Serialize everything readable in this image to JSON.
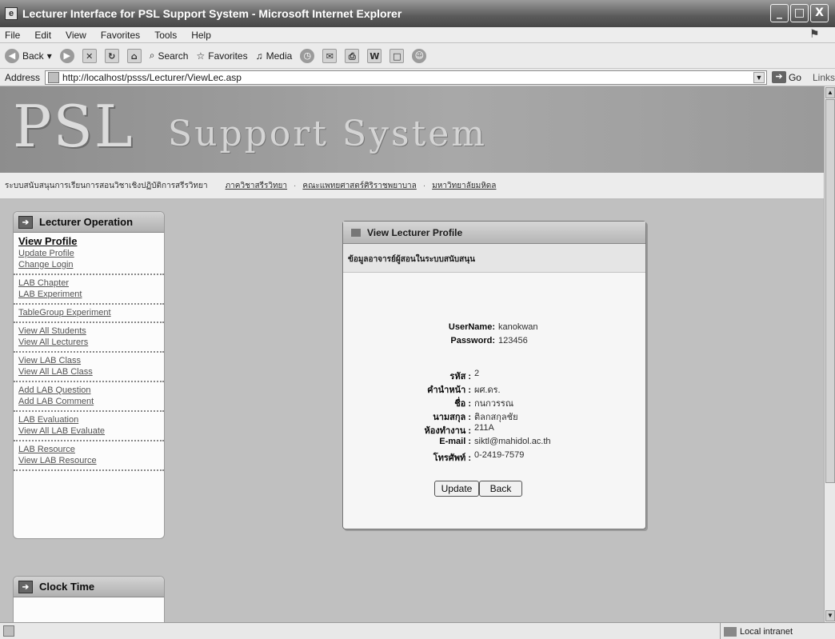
{
  "window": {
    "title": "Lecturer Interface for PSL Support System - Microsoft Internet Explorer",
    "controls": [
      "_",
      "□",
      "X"
    ]
  },
  "menu": [
    "File",
    "Edit",
    "View",
    "Favorites",
    "Tools",
    "Help"
  ],
  "toolbar": {
    "back": "Back",
    "search": "Search",
    "favorites": "Favorites",
    "media": "Media"
  },
  "address": {
    "label": "Address",
    "url": "http://localhost/psss/Lecturer/ViewLec.asp",
    "go": "Go",
    "links": "Links"
  },
  "banner": {
    "logo": "PSL",
    "logo_sub": "Support System"
  },
  "navstrip": {
    "system_name": "ระบบสนับสนุนการเรียนการสอนวิชาเชิงปฏิบัติการสรีรวิทยา",
    "links": [
      "ภาควิชาสรีรวิทยา",
      "คณะแพทยศาสตร์ศิริราชพยาบาล",
      "มหาวิทยาลัยมหิดล"
    ]
  },
  "left_panel": {
    "title": "Lecturer Operation",
    "groups": [
      [
        "View Profile",
        "Update Profile",
        "Change Login"
      ],
      [
        "LAB Chapter",
        "LAB Experiment"
      ],
      [
        "TableGroup Experiment"
      ],
      [
        "View All Students",
        "View All Lecturers"
      ],
      [
        "View LAB Class",
        "View All LAB Class"
      ],
      [
        "Add LAB Question",
        "Add LAB Comment"
      ],
      [
        "LAB Evaluation",
        "View All LAB Evaluate"
      ],
      [
        "LAB Resource",
        "View LAB Resource"
      ]
    ]
  },
  "clock_panel": {
    "title": "Clock Time"
  },
  "dialog": {
    "title": "View Lecturer Profile",
    "subtitle": "ข้อมูลอาจารย์ผู้สอนในระบบสนับสนุน",
    "login": [
      {
        "label": "UserName:",
        "value": "kanokwan"
      },
      {
        "label": "Password:",
        "value": "123456"
      }
    ],
    "fields": [
      {
        "label": "รหัส :",
        "value": "2"
      },
      {
        "label": "คำนำหน้า :",
        "value": "ผศ.ดร."
      },
      {
        "label": "ชื่อ :",
        "value": "กนกวรรณ"
      },
      {
        "label": "นามสกุล :",
        "value": "ติลกสกุลชัย"
      },
      {
        "label": "ห้องทำงาน :",
        "value": "211A"
      },
      {
        "label": "E-mail :",
        "value": "siktl@mahidol.ac.th"
      },
      {
        "label": "โทรศัพท์ :",
        "value": "0-2419-7579"
      }
    ],
    "buttons": {
      "update": "Update",
      "back": "Back"
    }
  },
  "status": {
    "zone": "Local intranet"
  }
}
